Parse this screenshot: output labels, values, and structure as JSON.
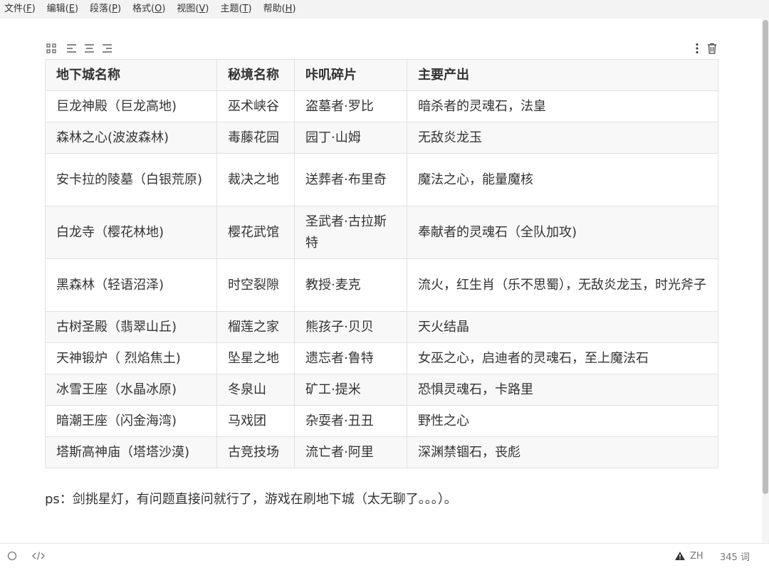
{
  "menubar": {
    "items": [
      {
        "label": "文件(",
        "key": "F",
        "end": ")"
      },
      {
        "label": "编辑(",
        "key": "E",
        "end": ")"
      },
      {
        "label": "段落(",
        "key": "P",
        "end": ")"
      },
      {
        "label": "格式(",
        "key": "O",
        "end": ")"
      },
      {
        "label": "视图(",
        "key": "V",
        "end": ")"
      },
      {
        "label": "主题(",
        "key": "T",
        "end": ")"
      },
      {
        "label": "帮助(",
        "key": "H",
        "end": ")"
      }
    ]
  },
  "table_toolbar": {
    "icons": [
      "grid-icon",
      "align-left-icon",
      "align-center-icon",
      "align-right-icon",
      "more-vertical-icon",
      "trash-icon"
    ]
  },
  "table": {
    "headers": [
      "地下城名称",
      "秘境名称",
      "咔叽碎片",
      "主要产出"
    ],
    "rows": [
      [
        "巨龙神殿（巨龙高地)",
        "巫术峡谷",
        "盗墓者·罗比",
        "暗杀者的灵魂石，法皇"
      ],
      [
        "森林之心(波波森林)",
        "毒藤花园",
        "园丁·山姆",
        "无敌炎龙玉"
      ],
      [
        "安卡拉的陵墓（白银荒原)",
        "裁决之地",
        "送葬者·布里奇",
        "魔法之心，能量魔核"
      ],
      [
        "白龙寺（樱花林地)",
        "樱花武馆",
        "圣武者·古拉斯特",
        "奉献者的灵魂石（全队加攻)"
      ],
      [
        "黑森林（轻语沼泽)",
        "时空裂隙",
        "教授·麦克",
        "流火，红生肖（乐不思蜀），无敌炎龙玉，时光斧子"
      ],
      [
        "古树圣殿（翡翠山丘)",
        "榴莲之家",
        "熊孩子·贝贝",
        "天火结晶"
      ],
      [
        "天神锻炉（ 烈焰焦土)",
        "坠星之地",
        "遗忘者·鲁特",
        "女巫之心，启迪者的灵魂石，至上魔法石"
      ],
      [
        "冰雪王座（水晶冰原)",
        "冬泉山",
        "矿工·提米",
        "恐惧灵魂石，卡路里"
      ],
      [
        "暗潮王座（闪金海湾)",
        "马戏团",
        "杂耍者·丑丑",
        "野性之心"
      ],
      [
        "塔斯高神庙（塔塔沙漠)",
        "古竞技场",
        "流亡者·阿里",
        "深渊禁锢石，丧彪"
      ]
    ]
  },
  "ps_text": "ps：剑挑星灯，有问题直接问就行了，游戏在刷地下城（太无聊了。。。）。",
  "statusbar": {
    "lang": "ZH",
    "word_count": "345 词"
  }
}
